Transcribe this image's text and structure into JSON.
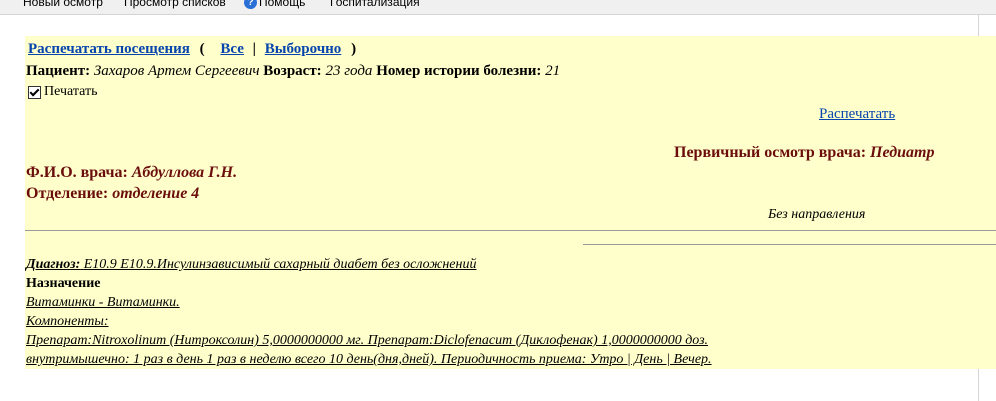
{
  "menu": {
    "new_exam": "Новый осмотр",
    "view_lists": "Просмотр списков",
    "help_icon_glyph": "?",
    "help": "Помощь",
    "hospitalization": "Госпитализация"
  },
  "links": {
    "print_visits": "Распечатать посещения",
    "open_paren": "(",
    "all": "Все",
    "divider": "|",
    "selective": "Выборочно",
    "close_paren": ")"
  },
  "patient": {
    "label": "Пациент:",
    "name": "Захаров Артем Сергеевич",
    "age_label": "Возраст:",
    "age": "23 года",
    "history_label": "Номер истории болезни:",
    "history_no": "21"
  },
  "print_checkbox": {
    "label": "Печатать",
    "checked": true
  },
  "print_link": "Распечатать",
  "exam": {
    "label": "Первичный осмотр врача:",
    "specialty": "Педиатр"
  },
  "doctor": {
    "label": "Ф.И.О. врача:",
    "name": "Абдуллова Г.Н."
  },
  "department": {
    "label": "Отделение:",
    "name": "отделение 4"
  },
  "no_referral": "Без направления",
  "diagnosis": {
    "label": "Диагноз:",
    "text": "E10.9 E10.9.Инсулинзависимый сахарный диабет без осложнений"
  },
  "prescription": {
    "title": "Назначение",
    "item": "Витаминки - Витаминки.",
    "components_label": "Компоненты:",
    "drugs": "Препарат:Nitroxolinum (Нитроксолин) 5,0000000000 мг. Препарат:Diclofenacum (Диклофенак) 1,0000000000 доз.",
    "regimen": "внутримышечно: 1 раз в день 1 раз в неделю всего 10 день(дня,дней). Периодичность приема: Утро | День | Вечер."
  },
  "colors": {
    "panel_bg": "#ffffcc",
    "link": "#0645ad",
    "heading_maroon": "#6b0d0d"
  }
}
